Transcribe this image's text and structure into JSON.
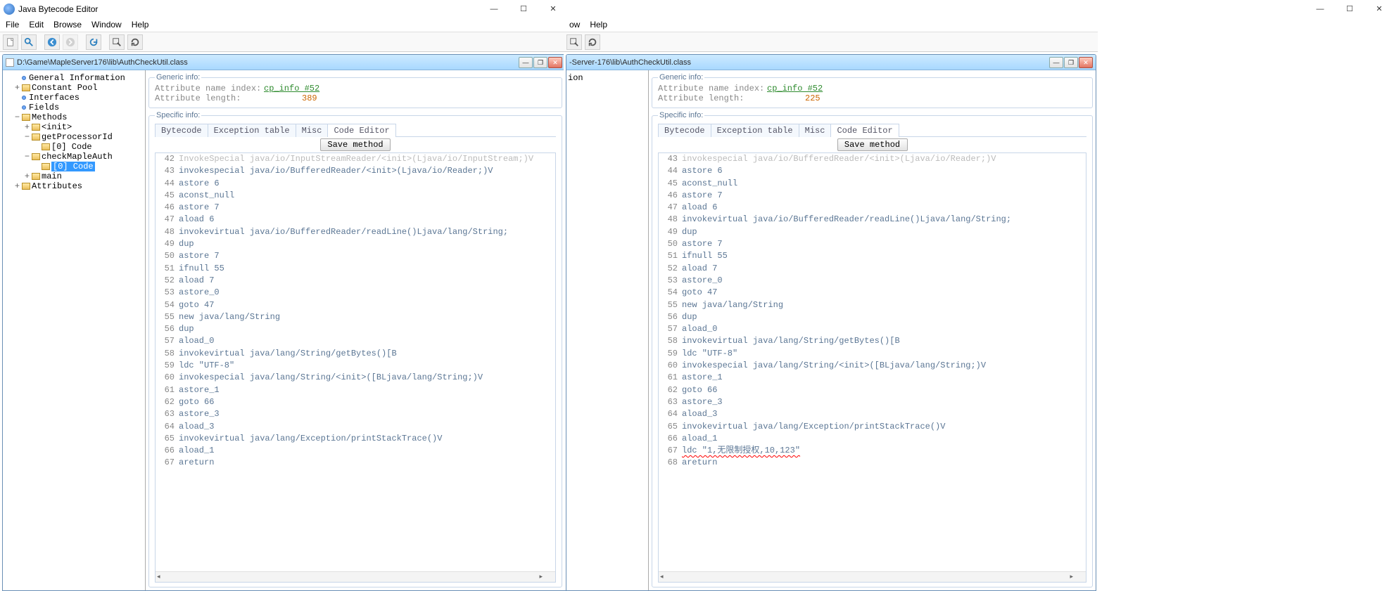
{
  "app_title": "Java Bytecode Editor",
  "menu": {
    "file": "File",
    "edit": "Edit",
    "browse": "Browse",
    "window": "Window",
    "help": "Help"
  },
  "inner_title_left": "D:\\Game\\MapleServer176\\lib\\AuthCheckUtil.class",
  "inner_title_right": "-Server-176\\lib\\AuthCheckUtil.class",
  "tree": {
    "general": "General Information",
    "constant": "Constant Pool",
    "interfaces": "Interfaces",
    "fields": "Fields",
    "methods": "Methods",
    "init": "<init>",
    "getProcessorId": "getProcessorId",
    "code0": "[0] Code",
    "checkMapleAuth": "checkMapleAuth",
    "code0b": "[0] Code",
    "main": "main",
    "attributes": "Attributes"
  },
  "tree2": {
    "ion": "ion"
  },
  "generic": {
    "title": "Generic info:",
    "attr_name_index_lbl": "Attribute name index:",
    "attr_name_index_val_left": "cp_info #52",
    "attr_name_index_val_right": "cp_info #52",
    "attr_len_lbl": "Attribute length:",
    "attr_len_val_left": "389",
    "attr_len_val_right": "225"
  },
  "specific_title": "Specific info:",
  "tabs": {
    "bytecode": "Bytecode",
    "exception": "Exception table",
    "misc": "Misc",
    "editor": "Code Editor"
  },
  "save_label": "Save method",
  "code_left": [
    {
      "n": 42,
      "t": "InvokeSpecial java/io/InputStreamReader/<init>(Ljava/io/InputStream;)V"
    },
    {
      "n": 43,
      "t": "invokespecial java/io/BufferedReader/<init>(Ljava/io/Reader;)V"
    },
    {
      "n": 44,
      "t": "astore 6"
    },
    {
      "n": 45,
      "t": "aconst_null"
    },
    {
      "n": 46,
      "t": "astore 7"
    },
    {
      "n": 47,
      "t": "aload 6"
    },
    {
      "n": 48,
      "t": "invokevirtual java/io/BufferedReader/readLine()Ljava/lang/String;"
    },
    {
      "n": 49,
      "t": "dup"
    },
    {
      "n": 50,
      "t": "astore 7"
    },
    {
      "n": 51,
      "t": "ifnull 55"
    },
    {
      "n": 52,
      "t": "aload 7"
    },
    {
      "n": 53,
      "t": "astore_0"
    },
    {
      "n": 54,
      "t": "goto 47"
    },
    {
      "n": 55,
      "t": "new java/lang/String"
    },
    {
      "n": 56,
      "t": "dup"
    },
    {
      "n": 57,
      "t": "aload_0"
    },
    {
      "n": 58,
      "t": "invokevirtual java/lang/String/getBytes()[B"
    },
    {
      "n": 59,
      "t": "ldc \"UTF-8\""
    },
    {
      "n": 60,
      "t": "invokespecial java/lang/String/<init>([BLjava/lang/String;)V"
    },
    {
      "n": 61,
      "t": "astore_1"
    },
    {
      "n": 62,
      "t": "goto 66"
    },
    {
      "n": 63,
      "t": "astore_3"
    },
    {
      "n": 64,
      "t": "aload_3"
    },
    {
      "n": 65,
      "t": "invokevirtual java/lang/Exception/printStackTrace()V"
    },
    {
      "n": 66,
      "t": "aload_1"
    },
    {
      "n": 67,
      "t": "areturn"
    }
  ],
  "code_right": [
    {
      "n": 43,
      "t": "invokespecial java/io/BufferedReader/<init>(Ljava/io/Reader;)V"
    },
    {
      "n": 44,
      "t": "astore 6"
    },
    {
      "n": 45,
      "t": "aconst_null"
    },
    {
      "n": 46,
      "t": "astore 7"
    },
    {
      "n": 47,
      "t": "aload 6"
    },
    {
      "n": 48,
      "t": "invokevirtual java/io/BufferedReader/readLine()Ljava/lang/String;"
    },
    {
      "n": 49,
      "t": "dup"
    },
    {
      "n": 50,
      "t": "astore 7"
    },
    {
      "n": 51,
      "t": "ifnull 55"
    },
    {
      "n": 52,
      "t": "aload 7"
    },
    {
      "n": 53,
      "t": "astore_0"
    },
    {
      "n": 54,
      "t": "goto 47"
    },
    {
      "n": 55,
      "t": "new java/lang/String"
    },
    {
      "n": 56,
      "t": "dup"
    },
    {
      "n": 57,
      "t": "aload_0"
    },
    {
      "n": 58,
      "t": "invokevirtual java/lang/String/getBytes()[B"
    },
    {
      "n": 59,
      "t": "ldc \"UTF-8\""
    },
    {
      "n": 60,
      "t": "invokespecial java/lang/String/<init>([BLjava/lang/String;)V"
    },
    {
      "n": 61,
      "t": "astore_1"
    },
    {
      "n": 62,
      "t": "goto 66"
    },
    {
      "n": 63,
      "t": "astore_3"
    },
    {
      "n": 64,
      "t": "aload_3"
    },
    {
      "n": 65,
      "t": "invokevirtual java/lang/Exception/printStackTrace()V"
    },
    {
      "n": 66,
      "t": "aload_1"
    },
    {
      "n": 67,
      "t": "ldc \"1,无限制授权,10,123\"",
      "hl": true
    },
    {
      "n": 68,
      "t": "areturn"
    }
  ]
}
